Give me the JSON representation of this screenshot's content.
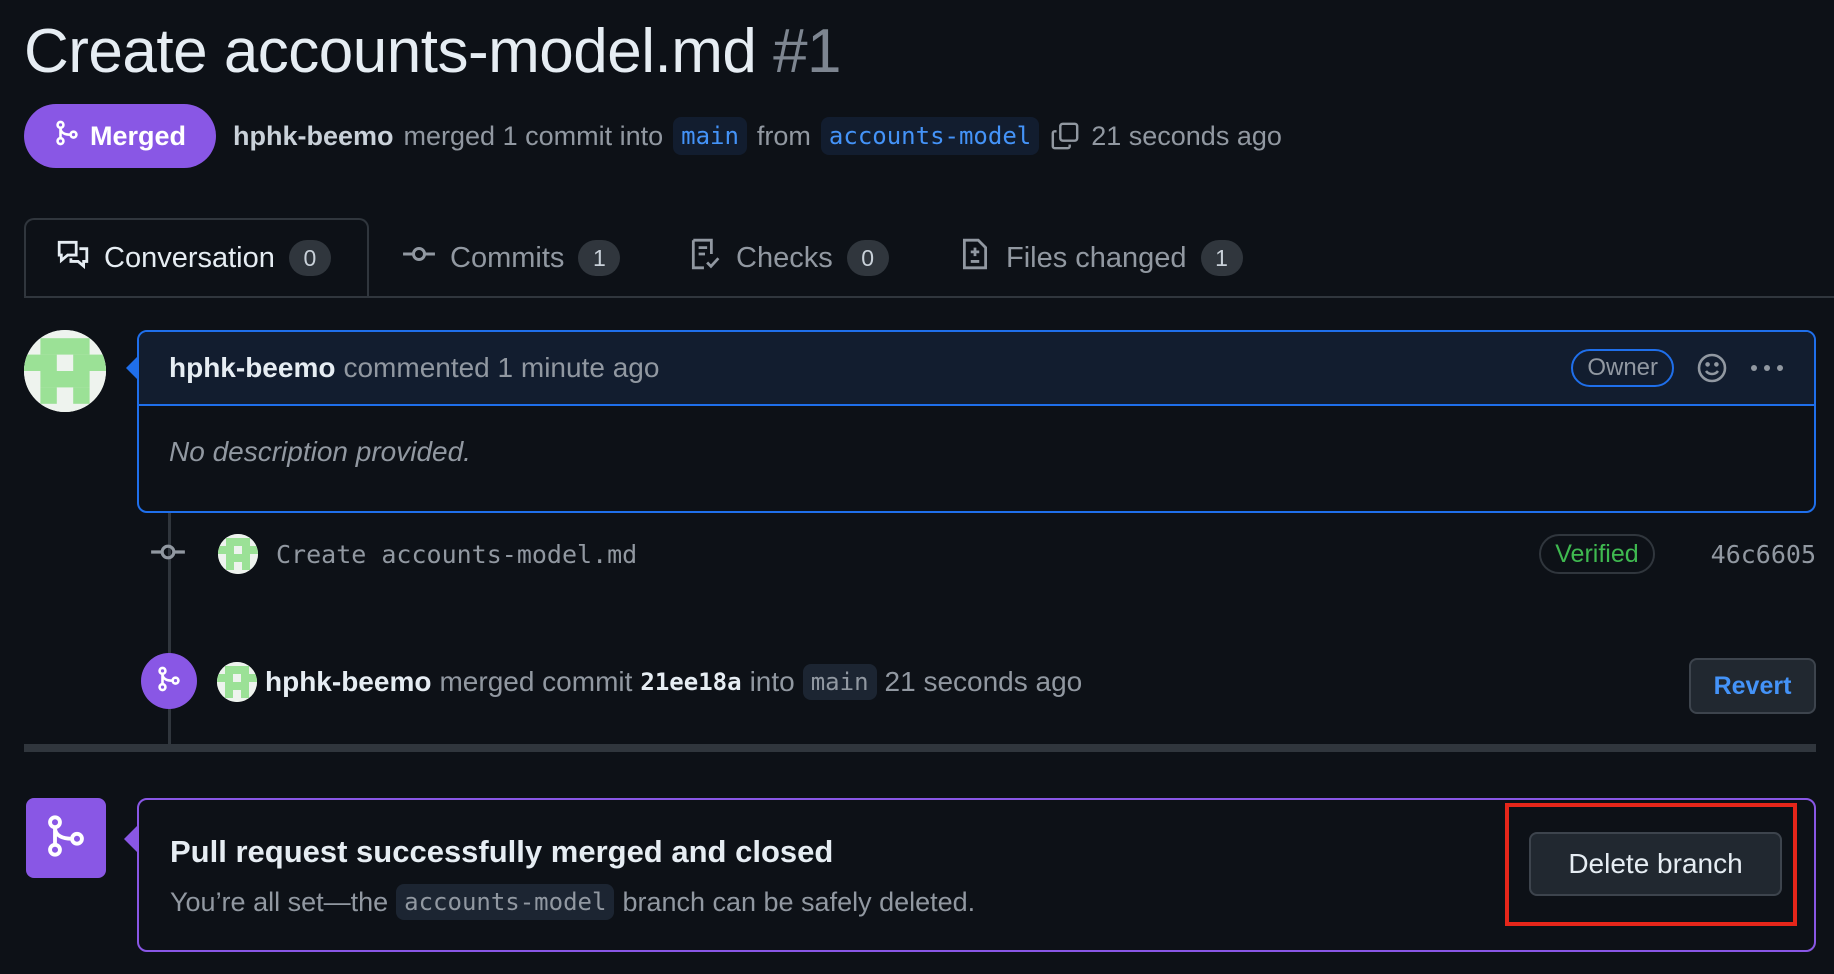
{
  "pr": {
    "title": "Create accounts-model.md",
    "number": "#1",
    "state_label": "Merged",
    "author": "hphk-beemo",
    "merged_text": "merged 1 commit into",
    "base_branch": "main",
    "from_text": "from",
    "head_branch": "accounts-model",
    "time": "21 seconds ago"
  },
  "tabs": [
    {
      "label": "Conversation",
      "count": "0",
      "icon": "comment-discussion-icon"
    },
    {
      "label": "Commits",
      "count": "1",
      "icon": "git-commit-icon"
    },
    {
      "label": "Checks",
      "count": "0",
      "icon": "checklist-icon"
    },
    {
      "label": "Files changed",
      "count": "1",
      "icon": "file-diff-icon"
    }
  ],
  "comment": {
    "author": "hphk-beemo",
    "meta": "commented 1 minute ago",
    "role_badge": "Owner",
    "body": "No description provided."
  },
  "commit": {
    "message": "Create accounts-model.md",
    "verified_label": "Verified",
    "sha": "46c6605"
  },
  "merge_event": {
    "author": "hphk-beemo",
    "merged_commit_text": "merged commit",
    "sha": "21ee18a",
    "into_text": "into",
    "branch": "main",
    "time": "21 seconds ago",
    "revert_label": "Revert"
  },
  "merged_box": {
    "title": "Pull request successfully merged and closed",
    "sub_prefix": "You’re all set—the",
    "branch": "accounts-model",
    "sub_suffix": "branch can be safely deleted.",
    "delete_label": "Delete branch"
  },
  "colors": {
    "background": "#0d1117",
    "merged_purple": "#8957e5",
    "accent_blue": "#1f6feb",
    "link_blue": "#4493f8",
    "verified_green": "#3fb950",
    "highlight_red": "#e5261a"
  }
}
